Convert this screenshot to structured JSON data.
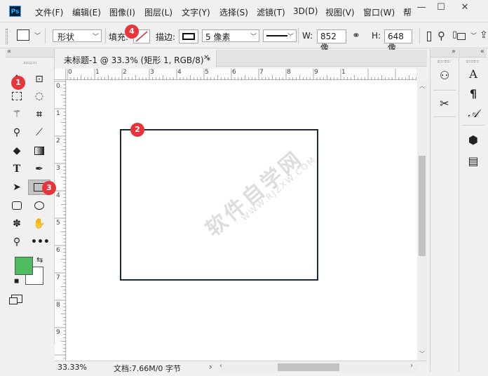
{
  "app": {
    "logo": "Ps",
    "menu": [
      "文件(F)",
      "编辑(E)",
      "图像(I)",
      "图层(L)",
      "文字(Y)",
      "选择(S)",
      "滤镜(T)",
      "3D(D)",
      "视图(V)",
      "窗口(W)",
      "帮"
    ],
    "window_controls": {
      "minimize": "—",
      "maximize": "☐",
      "close": "✕"
    }
  },
  "options": {
    "mode_value": "形状",
    "fill_label": "填充:",
    "stroke_label": "描边:",
    "stroke_width": "5 像素",
    "w_label": "W:",
    "w_value": "852 像",
    "h_label": "H:",
    "h_value": "648 像"
  },
  "document": {
    "tab_title": "未标题-1 @ 33.3% (矩形 1, RGB/8) *",
    "tab_close": "✕",
    "zoom": "33.33%",
    "doc_info": "文档:7.66M/0 字节",
    "status_arrow": "›",
    "ruler_h": [
      "0",
      "1",
      "2",
      "3",
      "4",
      "5",
      "6",
      "7",
      "8",
      "9",
      "1"
    ],
    "ruler_v": [
      "0",
      "1",
      "2",
      "3",
      "4",
      "5",
      "6",
      "7",
      "8",
      "9"
    ]
  },
  "watermark": {
    "main": "软件自学网",
    "sub": "WWW.RJZXW.COM"
  },
  "badges": [
    "1",
    "2",
    "3",
    "4"
  ],
  "colors": {
    "foreground": "#4dbb5f",
    "background": "#ffffff",
    "rect_stroke": "#1d2a3a",
    "badge": "#e8343a"
  },
  "right_panel": {
    "text_icon_a": "A",
    "paragraph_icon": "¶",
    "glyph_icon": "𝒜"
  },
  "panel_collapse": "«",
  "panel_expand": "»"
}
